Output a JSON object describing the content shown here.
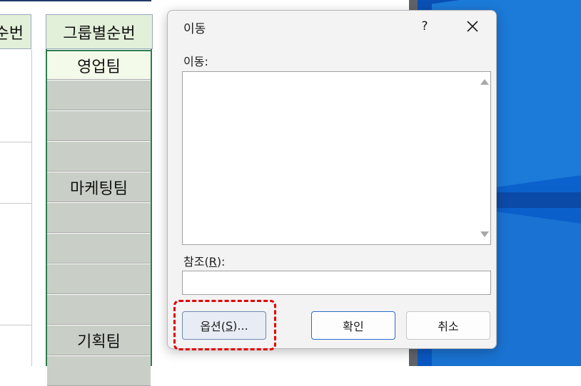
{
  "spreadsheet": {
    "left_header": "순번",
    "group_header": "그룹별순번",
    "groups": [
      {
        "label": "영업팀",
        "style": "light"
      },
      {
        "label": "",
        "style": "gray"
      },
      {
        "label": "",
        "style": "gray"
      },
      {
        "label": "",
        "style": "gray"
      },
      {
        "label": "마케팅팀",
        "style": "gray"
      },
      {
        "label": "",
        "style": "gray"
      },
      {
        "label": "",
        "style": "gray"
      },
      {
        "label": "",
        "style": "gray"
      },
      {
        "label": "",
        "style": "gray"
      },
      {
        "label": "기획팀",
        "style": "gray"
      },
      {
        "label": "",
        "style": "gray"
      }
    ]
  },
  "dialog": {
    "title": "이동",
    "help_label": "?",
    "goto_label": "이동:",
    "reference_label_prefix": "참조(",
    "reference_hotkey": "R",
    "reference_label_suffix": "):",
    "reference_value": "",
    "buttons": {
      "options_prefix": "옵션(",
      "options_hotkey": "S",
      "options_suffix": ")...",
      "ok": "확인",
      "cancel": "취소"
    }
  },
  "colors": {
    "header_fill": "#e2efd9",
    "group_border": "#2e7d4f",
    "gray_fill": "#c9cfc6",
    "highlight": "#e00000",
    "desktop_blue": "#0a57c2"
  }
}
